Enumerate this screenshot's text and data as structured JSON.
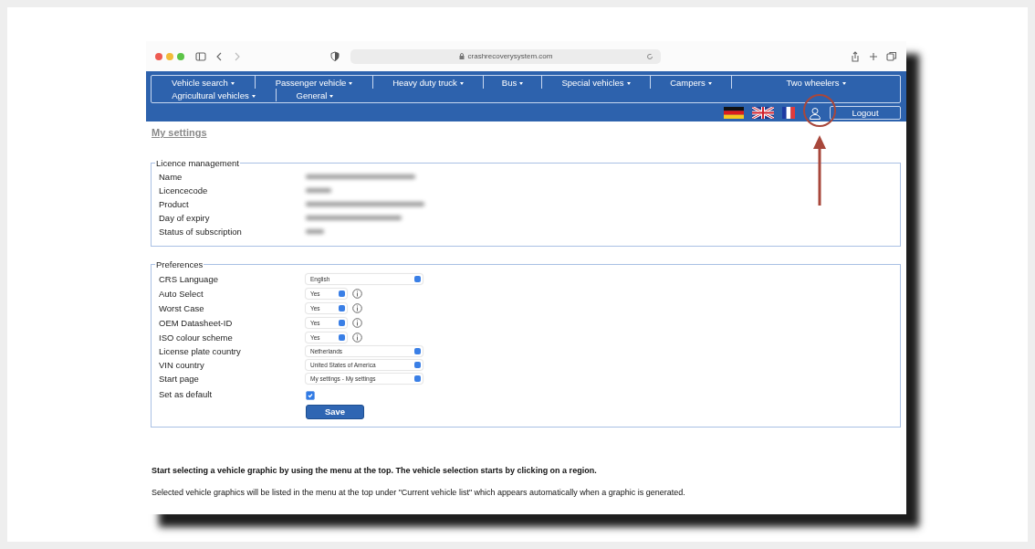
{
  "browser": {
    "url": "crashrecoverysystem.com"
  },
  "nav": {
    "rows": [
      [
        "Vehicle search",
        "Passenger vehicle",
        "Heavy duty truck",
        "Bus",
        "Special vehicles",
        "Campers",
        "Two wheelers"
      ],
      [
        "Agricultural vehicles",
        "General"
      ]
    ]
  },
  "logout": "Logout",
  "page_title": "My settings",
  "licence": {
    "legend": "Licence management",
    "rows": [
      {
        "label": "Name"
      },
      {
        "label": "Licencecode"
      },
      {
        "label": "Product"
      },
      {
        "label": "Day of expiry"
      },
      {
        "label": "Status of subscription"
      }
    ]
  },
  "preferences": {
    "legend": "Preferences",
    "rows": [
      {
        "label": "CRS Language",
        "kind": "wide",
        "value": "English"
      },
      {
        "label": "Auto Select",
        "kind": "short",
        "value": "Yes"
      },
      {
        "label": "Worst Case",
        "kind": "short",
        "value": "Yes"
      },
      {
        "label": "OEM Datasheet-ID",
        "kind": "short",
        "value": "Yes"
      },
      {
        "label": "ISO colour scheme",
        "kind": "short",
        "value": "Yes"
      },
      {
        "label": "License plate country",
        "kind": "wide",
        "value": "Netherlands"
      },
      {
        "label": "VIN country",
        "kind": "wide",
        "value": "United States of America"
      },
      {
        "label": "Start page",
        "kind": "wide",
        "value": "My settings - My settings"
      },
      {
        "label": "Set as default",
        "kind": "checkbox",
        "checked": true
      }
    ]
  },
  "save": "Save",
  "notes": [
    {
      "kind": "heading",
      "text": "Start selecting a vehicle graphic by using the menu at the top. The vehicle selection starts by clicking on a region."
    },
    {
      "kind": "plain",
      "text": "Selected vehicle graphics will be listed in the menu at the top under \"Current vehicle list\" which appears automatically when a graphic is generated."
    }
  ]
}
